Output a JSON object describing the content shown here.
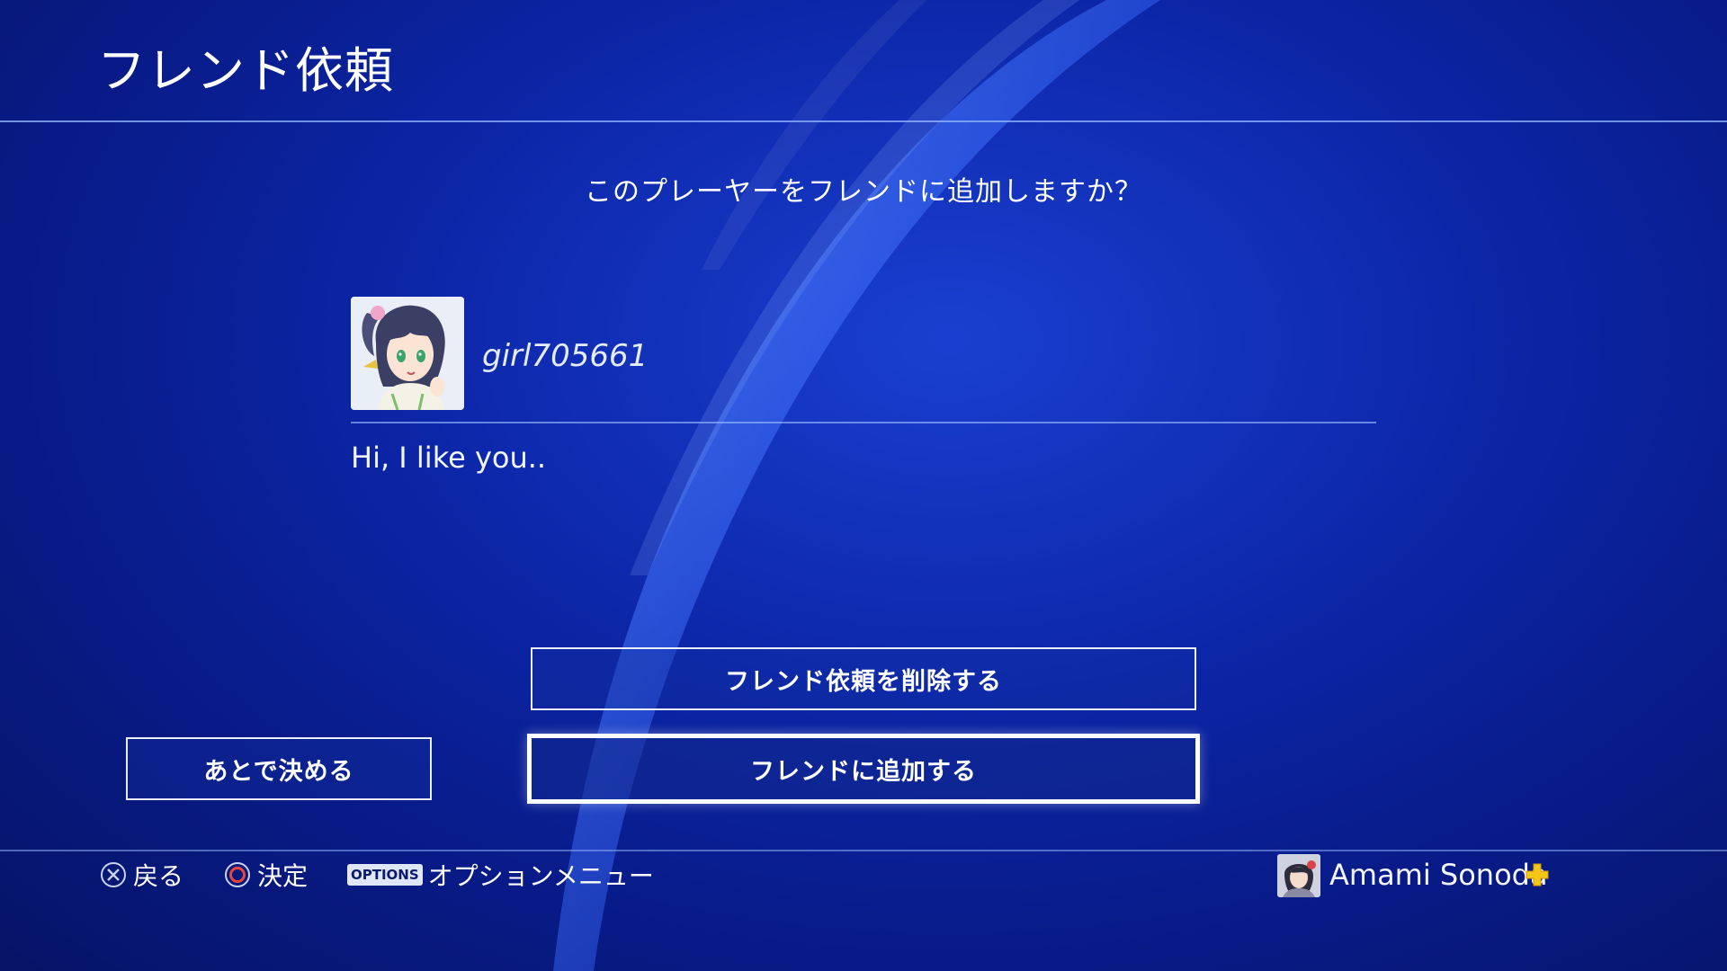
{
  "header": {
    "title": "フレンド依頼"
  },
  "dialog": {
    "question": "このプレーヤーをフレンドに追加しますか？"
  },
  "requester": {
    "avatar_icon": "anime-girl-avatar-icon",
    "username": "girl705661",
    "message": "Hi, I like you.."
  },
  "buttons": {
    "delete_label": "フレンド依頼を削除する",
    "later_label": "あとで決める",
    "add_label": "フレンドに追加する"
  },
  "footer": {
    "back_icon": "cross-button-icon",
    "back_label": "戻る",
    "confirm_icon": "circle-button-icon",
    "confirm_label": "決定",
    "options_badge": "OPTIONS",
    "options_label": "オプションメニュー",
    "user_avatar_icon": "user-avatar-icon",
    "user_name": "Amami Sonoda",
    "plus_icon": "playstation-plus-icon"
  },
  "colors": {
    "background": "#0c26a8",
    "divider": "#96b9ff",
    "button_border": "#ffffff",
    "circle_button": "#e8463c",
    "plus_gold": "#f5c518"
  }
}
